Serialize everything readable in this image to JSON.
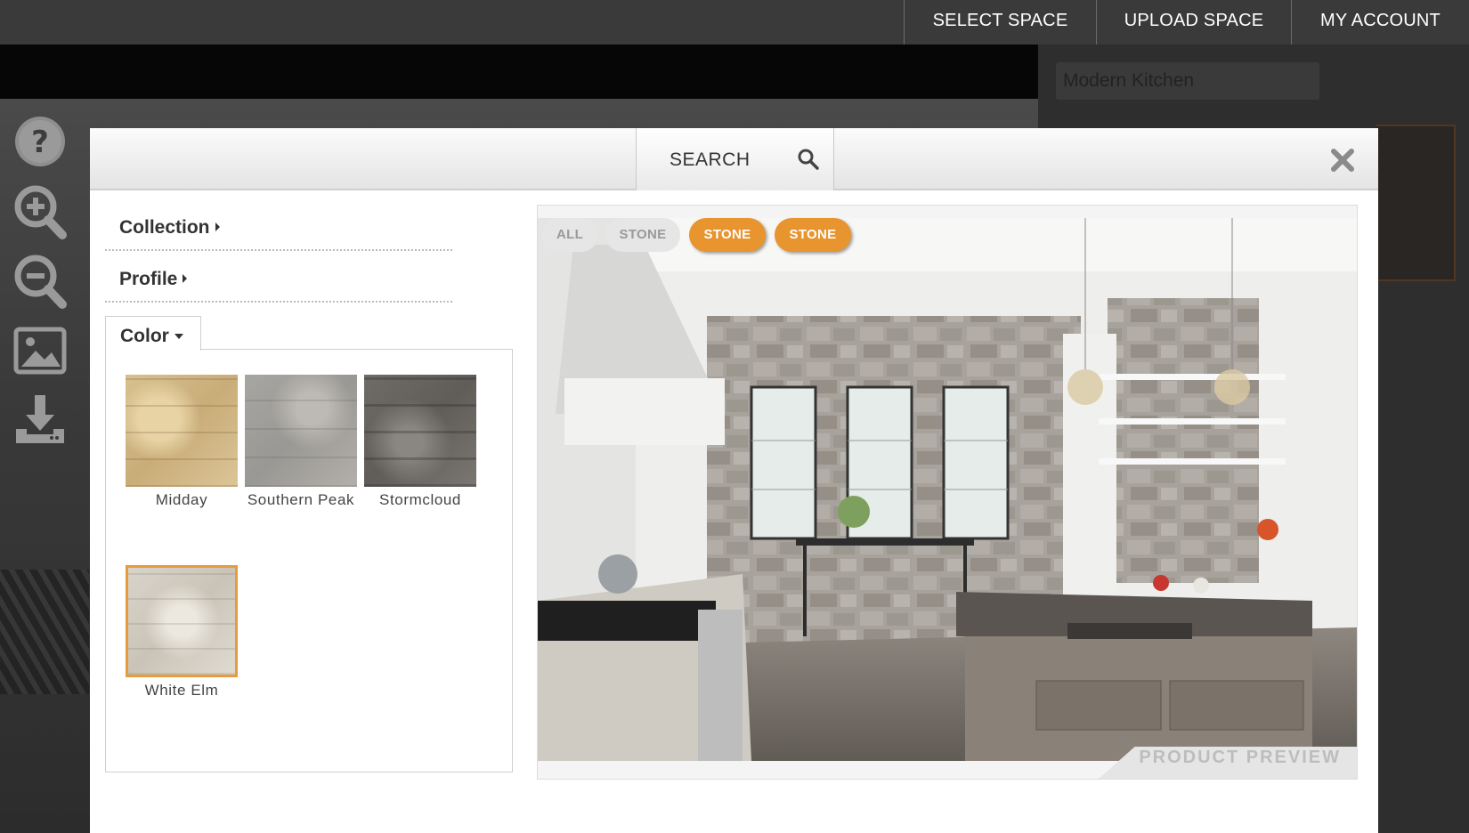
{
  "nav": {
    "select_space": "SELECT SPACE",
    "upload_space": "UPLOAD SPACE",
    "my_account": "MY ACCOUNT"
  },
  "space": {
    "name": "Modern Kitchen"
  },
  "toolbar": {
    "icons": [
      "help-icon",
      "zoom-in-icon",
      "zoom-out-icon",
      "image-icon",
      "download-icon"
    ]
  },
  "modal": {
    "search_label": "SEARCH",
    "filters": {
      "collection": "Collection",
      "profile": "Profile",
      "color": "Color"
    },
    "swatches": [
      {
        "name": "Midday",
        "selected": false
      },
      {
        "name": "Southern Peak",
        "selected": false
      },
      {
        "name": "Stormcloud",
        "selected": false
      },
      {
        "name": "White Elm",
        "selected": true
      }
    ],
    "preview": {
      "pills": [
        "ALL",
        "STONE",
        "STONE",
        "STONE"
      ],
      "label": "PRODUCT PREVIEW"
    }
  },
  "colors": {
    "accent": "#e8942f",
    "nav_bg": "#3a3a3a",
    "selected_border": "#e89b3c"
  }
}
